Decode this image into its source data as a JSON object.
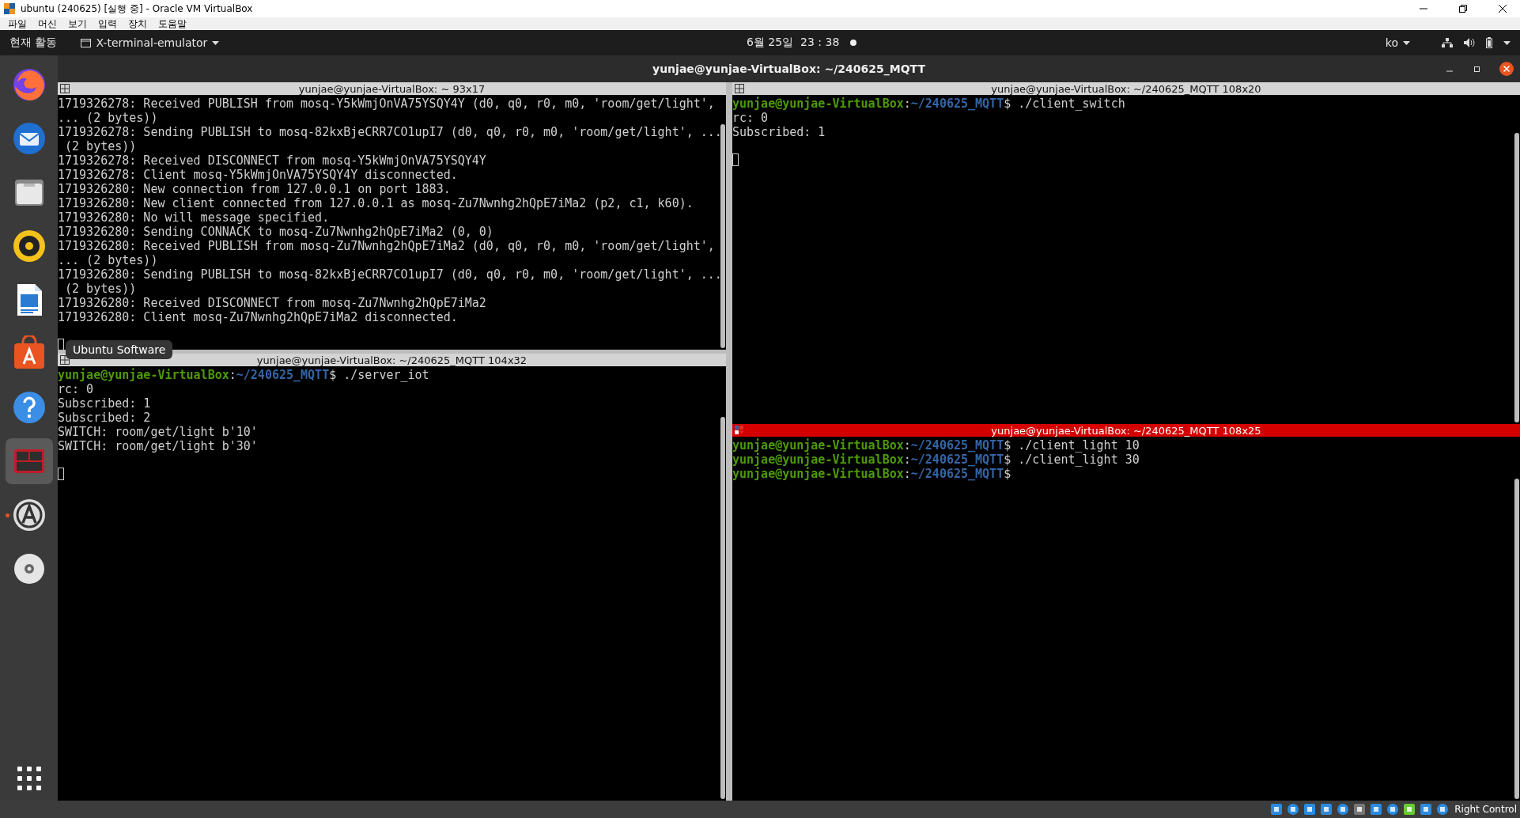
{
  "vbox": {
    "title": "ubuntu (240625) [실행 중] - Oracle VM VirtualBox",
    "menu": [
      "파일",
      "머신",
      "보기",
      "입력",
      "장치",
      "도움말"
    ],
    "status_text": "Right Control"
  },
  "topbar": {
    "activities": "현재 활동",
    "app_menu": "X-terminal-emulator",
    "clock": "6월 25일  23 : 38",
    "notification": true,
    "input_method": "ko"
  },
  "dock": {
    "tooltip": "Ubuntu Software",
    "items": [
      {
        "kind": "firefox",
        "selected": false,
        "running": false
      },
      {
        "kind": "thunderbird",
        "selected": false,
        "running": false
      },
      {
        "kind": "files",
        "selected": false,
        "running": false
      },
      {
        "kind": "rhythmbox",
        "selected": false,
        "running": false
      },
      {
        "kind": "writer",
        "selected": false,
        "running": false
      },
      {
        "kind": "software",
        "selected": false,
        "running": false
      },
      {
        "kind": "help",
        "selected": false,
        "running": false
      },
      {
        "kind": "terminal",
        "selected": true,
        "running": false
      },
      {
        "kind": "updater",
        "selected": false,
        "running": true
      },
      {
        "kind": "disc",
        "selected": false,
        "running": false
      }
    ]
  },
  "window": {
    "title": "yunjae@yunjae-VirtualBox: ~/240625_MQTT"
  },
  "left_panes": [
    {
      "title": "yunjae@yunjae-VirtualBox: ~ 93x17",
      "focused": false,
      "cursor": true,
      "lines": [
        {
          "kind": "output",
          "text": "1719326278: Received PUBLISH from mosq-Y5kWmjOnVA75YSQY4Y (d0, q0, r0, m0, 'room/get/light',"
        },
        {
          "kind": "output",
          "text": "... (2 bytes))"
        },
        {
          "kind": "output",
          "text": "1719326278: Sending PUBLISH to mosq-82kxBjeCRR7CO1upI7 (d0, q0, r0, m0, 'room/get/light', ..."
        },
        {
          "kind": "output",
          "text": " (2 bytes))"
        },
        {
          "kind": "output",
          "text": "1719326278: Received DISCONNECT from mosq-Y5kWmjOnVA75YSQY4Y"
        },
        {
          "kind": "output",
          "text": "1719326278: Client mosq-Y5kWmjOnVA75YSQY4Y disconnected."
        },
        {
          "kind": "output",
          "text": "1719326280: New connection from 127.0.0.1 on port 1883."
        },
        {
          "kind": "output",
          "text": "1719326280: New client connected from 127.0.0.1 as mosq-Zu7Nwnhg2hQpE7iMa2 (p2, c1, k60)."
        },
        {
          "kind": "output",
          "text": "1719326280: No will message specified."
        },
        {
          "kind": "output",
          "text": "1719326280: Sending CONNACK to mosq-Zu7Nwnhg2hQpE7iMa2 (0, 0)"
        },
        {
          "kind": "output",
          "text": "1719326280: Received PUBLISH from mosq-Zu7Nwnhg2hQpE7iMa2 (d0, q0, r0, m0, 'room/get/light',"
        },
        {
          "kind": "output",
          "text": "... (2 bytes))"
        },
        {
          "kind": "output",
          "text": "1719326280: Sending PUBLISH to mosq-82kxBjeCRR7CO1upI7 (d0, q0, r0, m0, 'room/get/light', ..."
        },
        {
          "kind": "output",
          "text": " (2 bytes))"
        },
        {
          "kind": "output",
          "text": "1719326280: Received DISCONNECT from mosq-Zu7Nwnhg2hQpE7iMa2"
        },
        {
          "kind": "output",
          "text": "1719326280: Client mosq-Zu7Nwnhg2hQpE7iMa2 disconnected."
        }
      ]
    },
    {
      "title": "yunjae@yunjae-VirtualBox: ~/240625_MQTT 104x32",
      "focused": false,
      "cursor": true,
      "lines": [
        {
          "kind": "prompt",
          "user": "yunjae@yunjae-VirtualBox",
          "separator": ":",
          "path": "~/240625_MQTT",
          "tail": "$ ./server_iot"
        },
        {
          "kind": "output",
          "text": "rc: 0"
        },
        {
          "kind": "output",
          "text": "Subscribed: 1"
        },
        {
          "kind": "output",
          "text": "Subscribed: 2"
        },
        {
          "kind": "output",
          "text": "SWITCH: room/get/light b'10'"
        },
        {
          "kind": "output",
          "text": "SWITCH: room/get/light b'30'"
        }
      ]
    }
  ],
  "right_panes": [
    {
      "title": "yunjae@yunjae-VirtualBox: ~/240625_MQTT 108x20",
      "focused": false,
      "cursor": true,
      "lines": [
        {
          "kind": "prompt",
          "user": "yunjae@yunjae-VirtualBox",
          "separator": ":",
          "path": "~/240625_MQTT",
          "tail": "$ ./client_switch"
        },
        {
          "kind": "output",
          "text": "rc: 0"
        },
        {
          "kind": "output",
          "text": "Subscribed: 1"
        }
      ]
    },
    {
      "title": "yunjae@yunjae-VirtualBox: ~/240625_MQTT 108x25",
      "focused": true,
      "cursor": false,
      "lines": [
        {
          "kind": "prompt",
          "user": "yunjae@yunjae-VirtualBox",
          "separator": ":",
          "path": "~/240625_MQTT",
          "tail": "$ ./client_light 10"
        },
        {
          "kind": "prompt",
          "user": "yunjae@yunjae-VirtualBox",
          "separator": ":",
          "path": "~/240625_MQTT",
          "tail": "$ ./client_light 30"
        },
        {
          "kind": "prompt",
          "user": "yunjae@yunjae-VirtualBox",
          "separator": ":",
          "path": "~/240625_MQTT",
          "tail": "$"
        }
      ]
    }
  ]
}
